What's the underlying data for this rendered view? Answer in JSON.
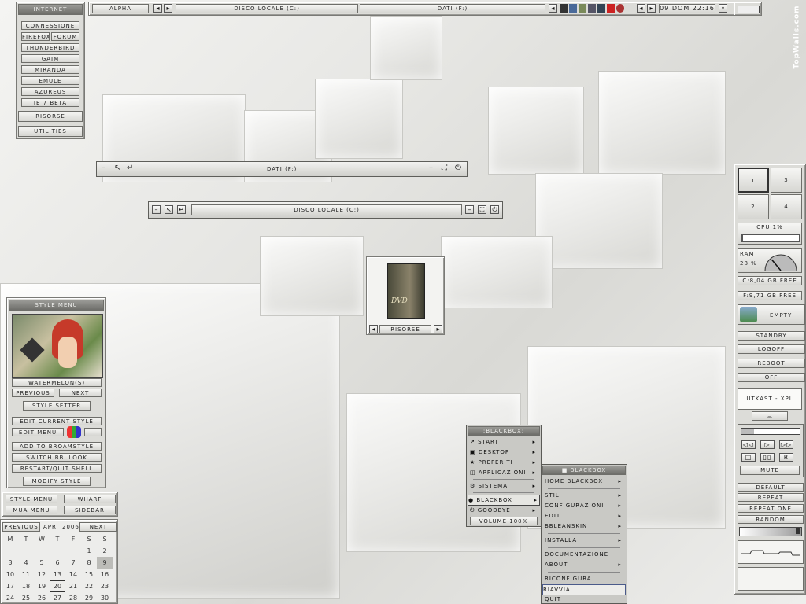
{
  "watermark": "TopWalls.com",
  "toolbar": {
    "workspace": "ALPHA",
    "tasks": [
      "DISCO LOCALE (C:)",
      "DATI (F:)"
    ],
    "clock": "09 DOM 22:16"
  },
  "internet_menu": {
    "title": "INTERNET",
    "items": [
      "CONNESSIONE",
      "FIREFOX",
      "FORUM",
      "THUNDERBIRD",
      "GAIM",
      "MIRANDA",
      "EMULE",
      "AZUREUS",
      "IE 7 BETA"
    ],
    "risorse": "RISORSE",
    "utilities": "UTILITIES"
  },
  "windows": {
    "dati": {
      "title": "DATI (F:)"
    },
    "disco": {
      "title": "DISCO LOCALE (C:)"
    }
  },
  "desktop_icon": {
    "label": "RISORSE",
    "art_text": "DVD"
  },
  "style_menu": {
    "title": "STYLE MENU",
    "style_name": "WATERMELON(S)",
    "previous": "PREVIOUS",
    "next": "NEXT",
    "style_setter": "STYLE SETTER",
    "edit_current": "EDIT CURRENT STYLE",
    "edit_menu": "EDIT MENU",
    "add_to": "ADD TO BROAMSTYLE",
    "switch": "SWITCH BBI LOOK",
    "restart": "RESTART/QUIT SHELL",
    "modify": "MODIFY STYLE"
  },
  "quick_buttons": [
    "STYLE MENU",
    "WHARF",
    "MUA MENU",
    "SIDEBAR"
  ],
  "calendar": {
    "prev": "PREVIOUS",
    "month": "APR",
    "year": "2006",
    "next": "NEXT",
    "weekdays": [
      "M",
      "T",
      "W",
      "T",
      "F",
      "S",
      "S"
    ],
    "weeks": [
      [
        "",
        "",
        "",
        "",
        "",
        "1",
        "2"
      ],
      [
        "3",
        "4",
        "5",
        "6",
        "7",
        "8",
        "9"
      ],
      [
        "10",
        "11",
        "12",
        "13",
        "14",
        "15",
        "16"
      ],
      [
        "17",
        "18",
        "19",
        "20",
        "21",
        "22",
        "23"
      ],
      [
        "24",
        "25",
        "26",
        "27",
        "28",
        "29",
        "30"
      ]
    ],
    "today": "20",
    "highlight": "9"
  },
  "sidebar": {
    "workspaces": [
      "1",
      "3",
      "2",
      "4"
    ],
    "cpu": "CPU 1%",
    "cpu_value": 1,
    "ram_label": "RAM",
    "ram": "28 %",
    "ram_value": 28,
    "disk_c": "C:8,04 GB FREE",
    "disk_f": "F:9,71 GB FREE",
    "recycle": "EMPTY",
    "standby": "STANDBY",
    "logoff": "LOGOFF",
    "reboot": "REBOOT",
    "off": "OFF",
    "player": "UTKAST - XPL",
    "mute": "MUTE",
    "default": "DEFAULT",
    "repeat": "REPEAT",
    "repeat_one": "REPEAT ONE",
    "random": "RANDOM"
  },
  "bb_menu": {
    "title": ":BLACKBOX:",
    "items": [
      "START",
      "DESKTOP",
      "PREFERITI",
      "APPLICAZIONI",
      "SISTEMA",
      "BLACKBOX",
      "GOODBYE",
      "VOLUME 100%"
    ]
  },
  "bb_sub": {
    "title": "BLACKBOX",
    "items": [
      "HOME BLACKBOX",
      "STILI",
      "CONFIGURAZIONI",
      "EDIT",
      "BBLEANSKIN",
      "INSTALLA",
      "DOCUMENTAZIONE",
      "ABOUT",
      "RICONFIGURA",
      "RIAVVIA",
      "QUIT"
    ]
  }
}
